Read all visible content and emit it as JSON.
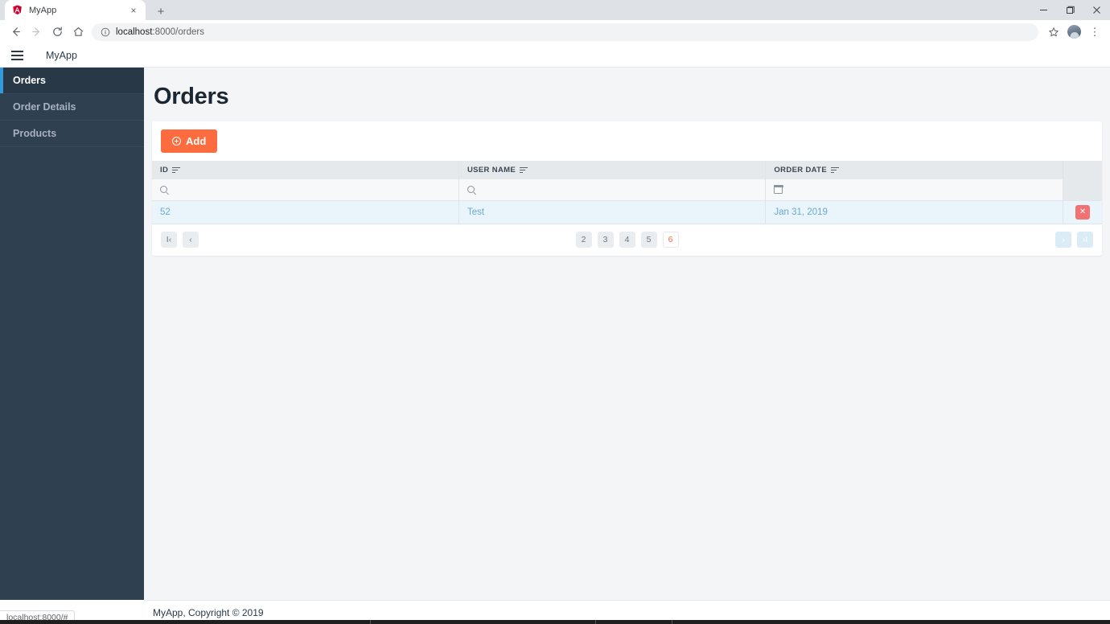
{
  "browser": {
    "tab": {
      "title": "MyApp",
      "favicon": "angular-logo-icon",
      "close_label": "×"
    },
    "new_tab_label": "+",
    "window_controls": {
      "minimize": "─",
      "maximize": "❐",
      "close": "✕"
    },
    "nav": {
      "back": "←",
      "forward": "→",
      "reload": "↻",
      "home": "⌂"
    },
    "omnibox": {
      "info_icon": "info-circle-icon",
      "host": "localhost",
      "rest": ":8000/orders",
      "full_url": "localhost:8000/orders"
    },
    "actions": {
      "bookmark": "☆",
      "menu": "⋮"
    },
    "status_bubble": "localhost:8000/#"
  },
  "app": {
    "navbar": {
      "menu_icon": "hamburger-icon",
      "brand": "MyApp"
    },
    "sidebar": {
      "items": [
        {
          "label": "Orders",
          "active": true
        },
        {
          "label": "Order Details",
          "active": false
        },
        {
          "label": "Products",
          "active": false
        }
      ]
    },
    "page": {
      "title": "Orders"
    },
    "toolbar": {
      "add_label": "Add",
      "add_icon": "plus-circle-icon"
    },
    "table": {
      "columns": [
        {
          "label": "ID",
          "sort_icon": "sort-icon"
        },
        {
          "label": "USER NAME",
          "sort_icon": "sort-icon"
        },
        {
          "label": "ORDER DATE",
          "sort_icon": "sort-icon"
        },
        {
          "label": "",
          "sort_icon": ""
        }
      ],
      "filters": [
        {
          "type": "search",
          "value": "",
          "placeholder": ""
        },
        {
          "type": "search",
          "value": "",
          "placeholder": ""
        },
        {
          "type": "date",
          "value": "",
          "placeholder": ""
        },
        {
          "type": "none",
          "value": "",
          "placeholder": ""
        }
      ],
      "rows": [
        {
          "id": "52",
          "user_name": "Test",
          "order_date": "Jan 31, 2019",
          "delete_label": "✕"
        }
      ]
    },
    "pagination": {
      "first_label": "I‹",
      "prev_label": "‹",
      "pages": [
        {
          "label": "2",
          "current": false
        },
        {
          "label": "3",
          "current": false
        },
        {
          "label": "4",
          "current": false
        },
        {
          "label": "5",
          "current": false
        },
        {
          "label": "6",
          "current": true
        }
      ],
      "next_label": "›",
      "last_label": "›I"
    },
    "footer": {
      "text": "MyApp, Copyright © 2019"
    }
  },
  "colors": {
    "accent_orange": "#fc6c3f",
    "sidebar_bg": "#2f4050",
    "sidebar_active_bg": "#293846",
    "sidebar_active_bar": "#3499d8",
    "row_highlight": "#e9f4fb",
    "link_blue": "#6aa9d4",
    "danger_red": "#f47173"
  }
}
